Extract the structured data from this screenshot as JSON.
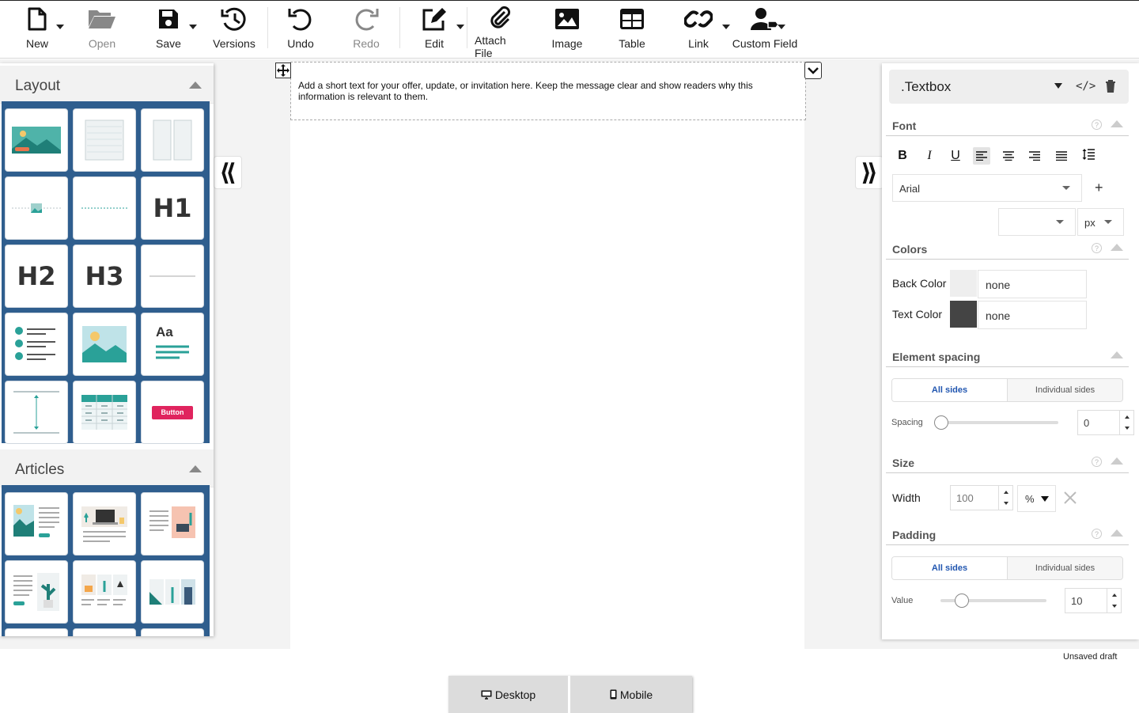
{
  "toolbar": {
    "new": "New",
    "open": "Open",
    "save": "Save",
    "versions": "Versions",
    "undo": "Undo",
    "redo": "Redo",
    "edit": "Edit",
    "attach_file": "Attach File",
    "image": "Image",
    "table": "Table",
    "link": "Link",
    "custom_field": "Custom Field"
  },
  "canvas": {
    "textbox_text": "Add a short text for your offer, update, or invitation here. Keep the message clear and show readers why this information is relevant to them."
  },
  "left_panel": {
    "layout_title": "Layout",
    "articles_title": "Articles",
    "tiles": {
      "h1": "H1",
      "h2": "H2",
      "h3": "H3",
      "aa": "Aa",
      "button": "Button"
    }
  },
  "right_panel": {
    "element_type": ".Textbox",
    "font": {
      "title": "Font",
      "family": "Arial",
      "size": "",
      "unit": "px"
    },
    "colors": {
      "title": "Colors",
      "back_color_label": "Back Color",
      "back_color_value": "none",
      "text_color_label": "Text Color",
      "text_color_value": "none",
      "back_swatch": "#eeeeee",
      "text_swatch": "#444444"
    },
    "spacing": {
      "title": "Element spacing",
      "all_sides": "All sides",
      "individual_sides": "Individual sides",
      "label": "Spacing",
      "value": "0",
      "slider_fraction": 0
    },
    "size": {
      "title": "Size",
      "width_label": "Width",
      "width_value": "100",
      "width_unit": "%"
    },
    "padding": {
      "title": "Padding",
      "all_sides": "All sides",
      "individual_sides": "Individual sides",
      "label": "Value",
      "value": "10",
      "slider_fraction": 0.2
    }
  },
  "status": "Unsaved draft",
  "view_switch": {
    "desktop": "Desktop",
    "mobile": "Mobile"
  },
  "colors": {
    "accent_blue": "#2f5e8e",
    "teal": "#2aa198",
    "button_red": "#e0245e"
  }
}
